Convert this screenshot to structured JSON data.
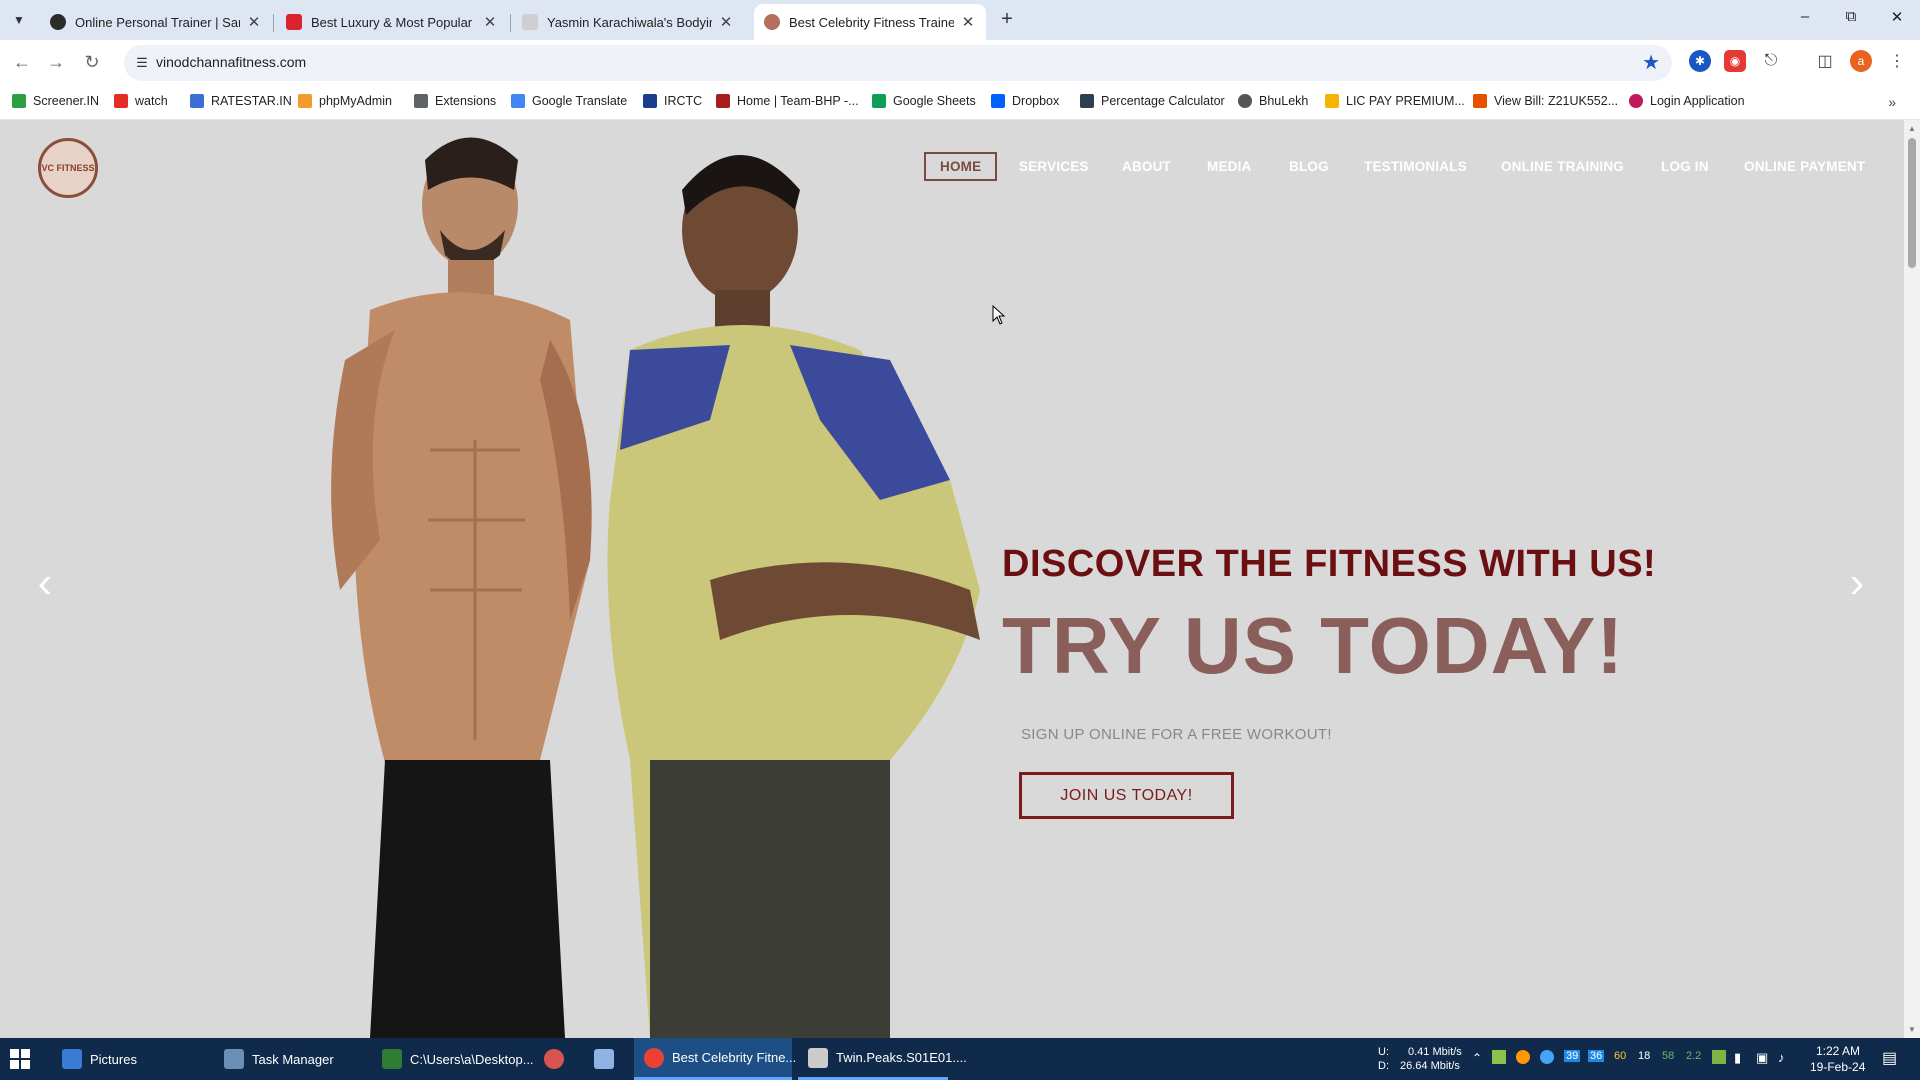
{
  "browser": {
    "tabs": [
      {
        "title": "Online Personal Trainer | Sarah",
        "favicon_color": "#2b2b2b",
        "active": false
      },
      {
        "title": "Best Luxury & Most Popular Gy",
        "favicon_color": "#d9232e",
        "active": false
      },
      {
        "title": "Yasmin Karachiwala's Bodyimag",
        "favicon_color": "#cfcfcf",
        "active": false
      },
      {
        "title": "Best Celebrity Fitness Trainer in",
        "favicon_color": "#b3705c",
        "active": true
      }
    ],
    "new_tab_icon": "plus-icon",
    "window_controls": [
      "minimize-icon",
      "restore-icon",
      "close-icon"
    ],
    "address": "vinodchannafitness.com",
    "bookmarks": [
      {
        "label": "Screener.IN",
        "color": "#2e9e42"
      },
      {
        "label": "watch",
        "color": "#e52d27"
      },
      {
        "label": "RATESTAR.IN",
        "color": "#3b6fd6"
      },
      {
        "label": "phpMyAdmin",
        "color": "#f29a2e"
      },
      {
        "label": "Extensions",
        "color": "#5f6368"
      },
      {
        "label": "Google Translate",
        "color": "#4285f4"
      },
      {
        "label": "IRCTC",
        "color": "#1a3e8c"
      },
      {
        "label": "Home | Team-BHP -...",
        "color": "#a51d1d"
      },
      {
        "label": "Google Sheets",
        "color": "#0f9d58"
      },
      {
        "label": "Dropbox",
        "color": "#0061fe"
      },
      {
        "label": "Percentage Calculator",
        "color": "#2c3e50"
      },
      {
        "label": "BhuLekh",
        "color": "#555555"
      },
      {
        "label": "LIC PAY PREMIUM...",
        "color": "#f4b400"
      },
      {
        "label": "View Bill: Z21UK552...",
        "color": "#e65100"
      },
      {
        "label": "Login Application",
        "color": "#c2185b"
      }
    ]
  },
  "site": {
    "logo_text": "VC FITNESS",
    "nav": [
      "HOME",
      "SERVICES",
      "ABOUT",
      "MEDIA",
      "BLOG",
      "TESTIMONIALS",
      "ONLINE TRAINING",
      "LOG IN",
      "ONLINE PAYMENT"
    ],
    "hero": {
      "subheading": "DISCOVER THE FITNESS WITH US!",
      "heading": "TRY US TODAY!",
      "note": "SIGN UP ONLINE FOR A FREE WORKOUT!",
      "button": "JOIN US TODAY!"
    },
    "colors": {
      "accent": "#6b0f12",
      "heading": "#8a5e5a",
      "background": "#d9d9d9"
    }
  },
  "taskbar": {
    "items": [
      {
        "label": "Pictures",
        "color": "#3a7bd5",
        "state": "normal"
      },
      {
        "label": "Task Manager",
        "color": "#6b8fb5",
        "state": "normal"
      },
      {
        "label": "C:\\Users\\a\\Desktop...",
        "color": "#2e7d32",
        "state": "normal"
      },
      {
        "label": "",
        "color": "#d9534f",
        "state": "normal"
      },
      {
        "label": "",
        "color": "#8fb4e3",
        "state": "normal"
      },
      {
        "label": "Best Celebrity Fitne...",
        "color": "#e94235",
        "state": "active"
      },
      {
        "label": "Twin.Peaks.S01E01....",
        "color": "#cccccc",
        "state": "running"
      }
    ],
    "net": {
      "up": "U:",
      "up_value": "0.41 Mbit/s",
      "down": "D:",
      "down_value": "26.64 Mbit/s"
    },
    "tray_numbers": [
      "39",
      "36",
      "60",
      "18",
      "58",
      "2.2"
    ],
    "time": "1:22 AM",
    "date": "19-Feb-24"
  }
}
